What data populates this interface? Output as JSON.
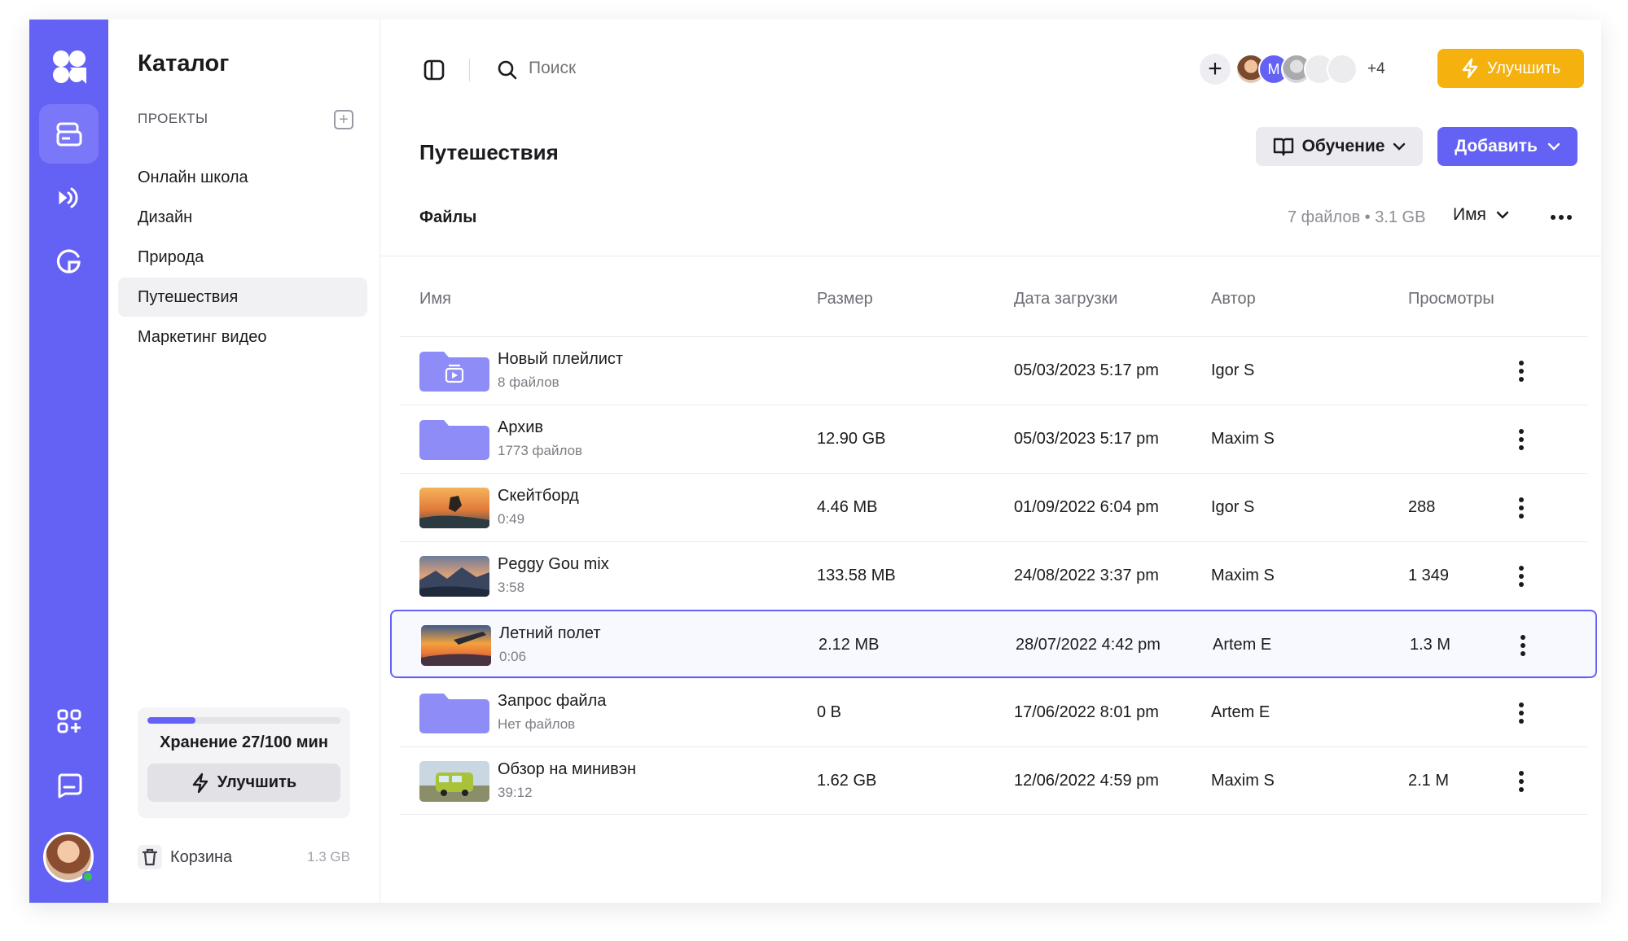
{
  "rail": {
    "items": [
      {
        "icon": "logo-icon"
      },
      {
        "icon": "storage-icon",
        "active": true
      },
      {
        "icon": "broadcast-icon"
      },
      {
        "icon": "analytics-icon"
      },
      {
        "icon": "apps-add-icon"
      },
      {
        "icon": "chat-icon"
      }
    ],
    "accent": "#6461f5",
    "online_color": "#36c45a"
  },
  "sidebar": {
    "title": "Каталог",
    "section_label": "ПРОЕКТЫ",
    "projects": [
      {
        "label": "Онлайн школа"
      },
      {
        "label": "Дизайн"
      },
      {
        "label": "Природа"
      },
      {
        "label": "Путешествия",
        "active": true
      },
      {
        "label": "Маркетинг видео"
      }
    ],
    "storage": {
      "text": "Хранение 27/100 мин",
      "used_fraction": 0.25,
      "upgrade_label": "Улучшить"
    },
    "trash": {
      "label": "Корзина",
      "size": "1.3 GB"
    }
  },
  "topbar": {
    "search_placeholder": "Поиск",
    "collaborator_initial": "M",
    "more_collaborators": "+4",
    "upgrade_label": "Улучшить",
    "upgrade_color": "#f5b20f"
  },
  "page": {
    "title": "Путешествия",
    "learn_label": "Обучение",
    "add_label": "Добавить",
    "files_label": "Файлы",
    "files_meta": "7 файлов • 3.1 GB",
    "sort_label": "Имя"
  },
  "table": {
    "headers": {
      "name": "Имя",
      "size": "Размер",
      "date": "Дата загрузки",
      "author": "Автор",
      "views": "Просмотры"
    },
    "rows": [
      {
        "name": "Новый плейлист",
        "sub": "8 файлов",
        "size": "",
        "date": "05/03/2023 5:17 pm",
        "author": "Igor S",
        "views": "",
        "kind": "playlist"
      },
      {
        "name": "Архив",
        "sub": "1773 файлов",
        "size": "12.90 GB",
        "date": "05/03/2023 5:17 pm",
        "author": "Maxim S",
        "views": "",
        "kind": "folder"
      },
      {
        "name": "Скейтборд",
        "sub": "0:49",
        "size": "4.46 MB",
        "date": "01/09/2022 6:04 pm",
        "author": "Igor S",
        "views": "288",
        "kind": "video-skate"
      },
      {
        "name": "Peggy Gou mix",
        "sub": "3:58",
        "size": "133.58 MB",
        "date": "24/08/2022 3:37 pm",
        "author": "Maxim S",
        "views": "1 349",
        "kind": "video-mountains"
      },
      {
        "name": "Летний полет",
        "sub": "0:06",
        "size": "2.12 MB",
        "date": "28/07/2022 4:42 pm",
        "author": "Artem E",
        "views": "1.3 M",
        "kind": "video-plane",
        "selected": true
      },
      {
        "name": "Запрос файла",
        "sub": "Нет файлов",
        "size": "0 B",
        "date": "17/06/2022 8:01 pm",
        "author": "Artem E",
        "views": "",
        "kind": "folder"
      },
      {
        "name": "Обзор на минивэн",
        "sub": "39:12",
        "size": "1.62 GB",
        "date": "12/06/2022 4:59 pm",
        "author": "Maxim S",
        "views": "2.1 M",
        "kind": "video-van"
      }
    ]
  }
}
